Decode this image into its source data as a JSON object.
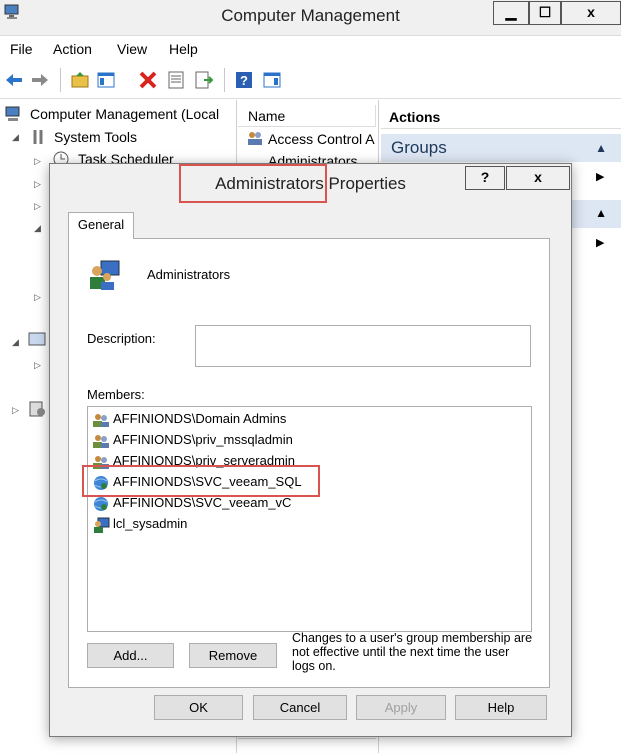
{
  "window": {
    "title": "Computer Management",
    "min": "▁",
    "max": "☐",
    "close": "x"
  },
  "menu": [
    "File",
    "Action",
    "View",
    "Help"
  ],
  "tree": {
    "root": "Computer Management (Local",
    "system_tools": "System Tools",
    "task_scheduler": "Task Scheduler"
  },
  "list": {
    "column": "Name",
    "items": [
      "Access Control A",
      "Administrators"
    ]
  },
  "actions": {
    "header": "Actions",
    "groups": "Groups"
  },
  "dialog": {
    "title": "Administrators Properties",
    "help": "?",
    "close": "x",
    "tab": "General",
    "group_name": "Administrators",
    "description_label": "Description:",
    "description_value": "",
    "members_label": "Members:",
    "members": [
      {
        "name": "AFFINIONDS\\Domain Admins",
        "icon": "group-icon"
      },
      {
        "name": "AFFINIONDS\\priv_mssqladmin",
        "icon": "group-icon"
      },
      {
        "name": "AFFINIONDS\\priv_serveradmin",
        "icon": "group-icon"
      },
      {
        "name": "AFFINIONDS\\SVC_veeam_SQL",
        "icon": "domain-user-icon"
      },
      {
        "name": "AFFINIONDS\\SVC_veeam_vC",
        "icon": "domain-user-icon"
      },
      {
        "name": "lcl_sysadmin",
        "icon": "local-user-icon"
      }
    ],
    "add": "Add...",
    "remove": "Remove",
    "note": "Changes to a user's group membership are not effective until the next time the user logs on.",
    "ok": "OK",
    "cancel": "Cancel",
    "apply": "Apply",
    "help_btn": "Help"
  },
  "colors": {
    "highlight": "#d9534f",
    "actions_bg": "#dde6f3"
  }
}
